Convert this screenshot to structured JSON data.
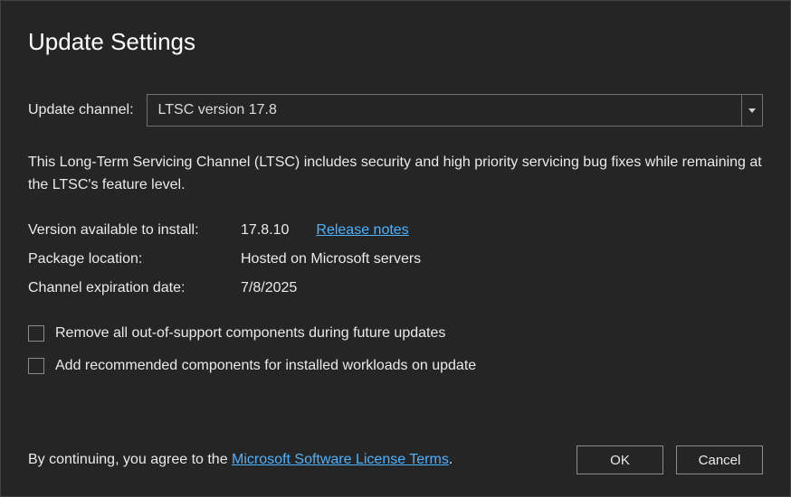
{
  "title": "Update Settings",
  "channel": {
    "label": "Update channel:",
    "selected": "LTSC version 17.8"
  },
  "description": "This Long-Term Servicing Channel (LTSC) includes security and high priority servicing bug fixes while remaining at the LTSC's feature level.",
  "info": {
    "version_label": "Version available to install:",
    "version_value": "17.8.10",
    "release_notes_link": "Release notes",
    "package_label": "Package location:",
    "package_value": "Hosted on Microsoft servers",
    "expiration_label": "Channel expiration date:",
    "expiration_value": "7/8/2025"
  },
  "checkboxes": {
    "remove_components": "Remove all out-of-support components during future updates",
    "add_recommended": "Add recommended components for installed workloads on update"
  },
  "footer": {
    "agree_prefix": "By continuing, you agree to the ",
    "license_link": "Microsoft Software License Terms",
    "agree_suffix": ".",
    "ok_label": "OK",
    "cancel_label": "Cancel"
  }
}
